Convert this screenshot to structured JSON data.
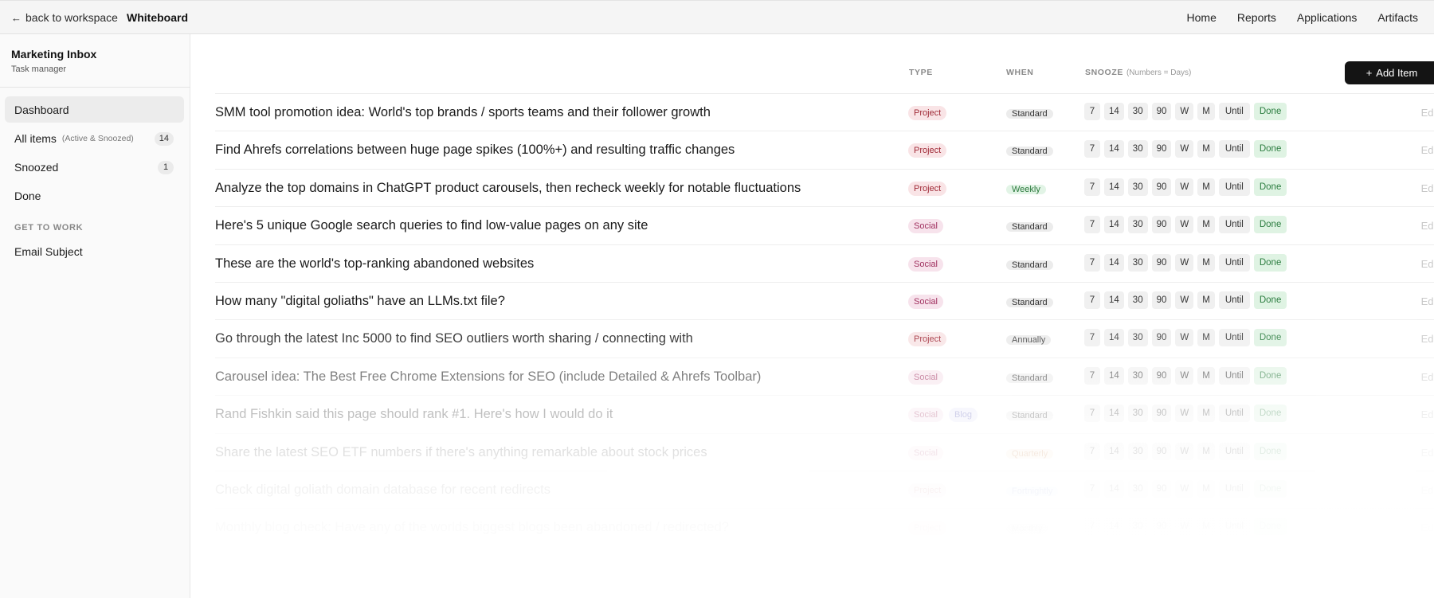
{
  "topbar": {
    "back_label": "back to workspace",
    "page_title": "Whiteboard",
    "nav": [
      "Home",
      "Reports",
      "Applications",
      "Artifacts"
    ]
  },
  "sidebar": {
    "title": "Marketing Inbox",
    "subtitle": "Task manager",
    "items": [
      {
        "label": "Dashboard",
        "hint": "",
        "count": ""
      },
      {
        "label": "All items",
        "hint": "(Active & Snoozed)",
        "count": "14"
      },
      {
        "label": "Snoozed",
        "hint": "",
        "count": "1"
      },
      {
        "label": "Done",
        "hint": "",
        "count": ""
      }
    ],
    "section_label": "GET TO WORK",
    "section_items": [
      {
        "label": "Email Subject"
      }
    ]
  },
  "table": {
    "headers": {
      "type": "TYPE",
      "when": "WHEN",
      "snooze": "SNOOZE",
      "snooze_hint": "(Numbers = Days)"
    },
    "add_label": "Add Item",
    "snooze_options": [
      "7",
      "14",
      "30",
      "90",
      "W",
      "M",
      "Until"
    ],
    "done_label": "Done",
    "edit_label": "Edit",
    "rows": [
      {
        "title": "SMM tool promotion idea: World's top brands / sports teams and their follower growth",
        "types": [
          "Project"
        ],
        "when": "Standard"
      },
      {
        "title": "Find Ahrefs correlations between huge page spikes (100%+) and resulting traffic changes",
        "types": [
          "Project"
        ],
        "when": "Standard"
      },
      {
        "title": "Analyze the top domains in ChatGPT product carousels, then recheck weekly for notable fluctuations",
        "types": [
          "Project"
        ],
        "when": "Weekly"
      },
      {
        "title": "Here's 5 unique Google search queries to find low-value pages on any site",
        "types": [
          "Social"
        ],
        "when": "Standard"
      },
      {
        "title": "These are the world's top-ranking abandoned websites",
        "types": [
          "Social"
        ],
        "when": "Standard"
      },
      {
        "title": "How many \"digital goliaths\" have an LLMs.txt file?",
        "types": [
          "Social"
        ],
        "when": "Standard"
      },
      {
        "title": "Go through the latest Inc 5000 to find SEO outliers worth sharing / connecting with",
        "types": [
          "Project"
        ],
        "when": "Annually"
      },
      {
        "title": "Carousel idea: The Best Free Chrome Extensions for SEO (include Detailed & Ahrefs Toolbar)",
        "types": [
          "Social"
        ],
        "when": "Standard"
      },
      {
        "title": "Rand Fishkin said this page should rank #1. Here's how I would do it",
        "types": [
          "Social",
          "Blog"
        ],
        "when": "Standard"
      },
      {
        "title": "Share the latest SEO ETF numbers if there's anything remarkable about stock prices",
        "types": [
          "Social"
        ],
        "when": "Quarterly"
      },
      {
        "title": "Check digital goliath domain database for recent redirects",
        "types": [
          "Project"
        ],
        "when": "Fortnightly"
      },
      {
        "title": "Monthly blog check: Have any of the worlds biggest blogs been abandoned / redirected?",
        "types": [
          "Project"
        ],
        "when": "Monthly"
      }
    ]
  }
}
